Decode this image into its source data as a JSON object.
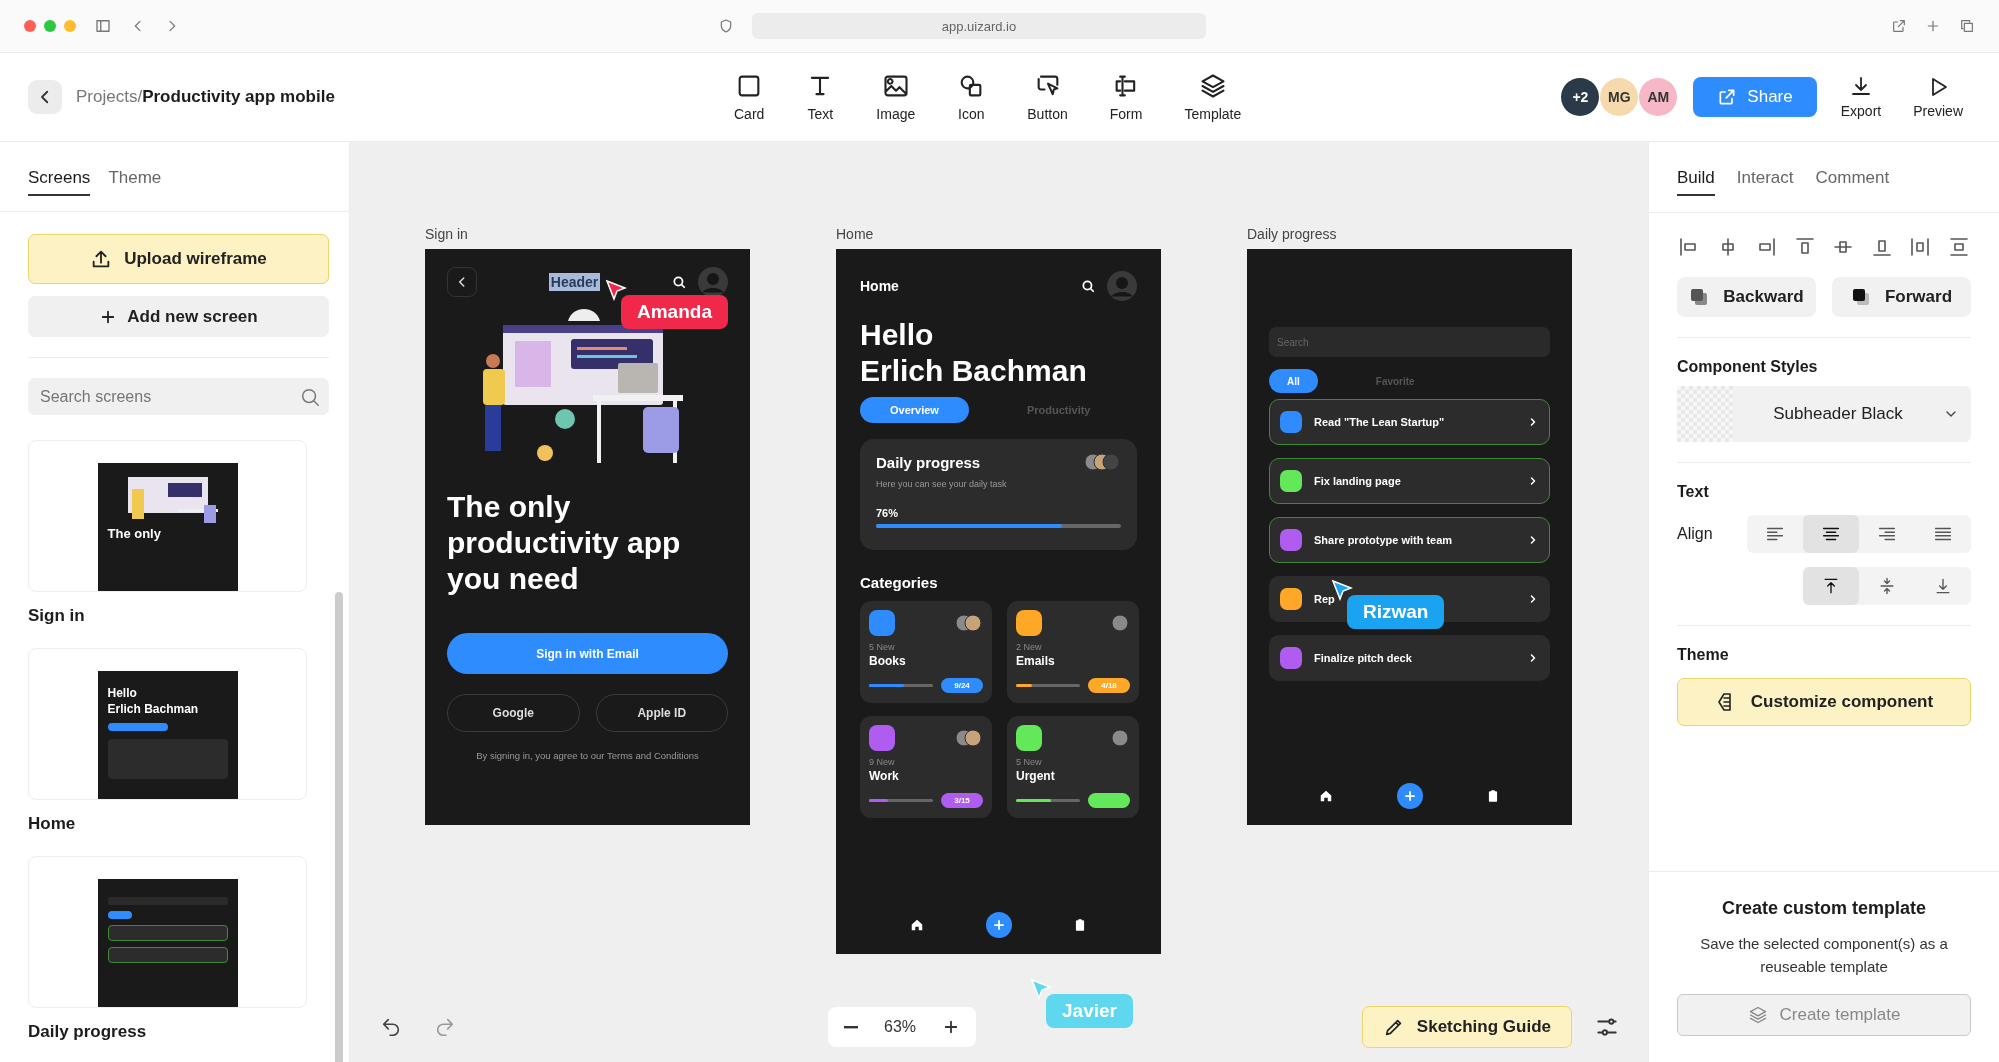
{
  "browser": {
    "url": "app.uizard.io"
  },
  "toolbar": {
    "breadcrumb_parent": "Projects",
    "breadcrumb_separator": "/",
    "breadcrumb_current": "Productivity app mobile",
    "tools": [
      {
        "label": "Card",
        "kind": "card"
      },
      {
        "label": "Text",
        "kind": "text"
      },
      {
        "label": "Image",
        "kind": "image"
      },
      {
        "label": "Icon",
        "kind": "icon"
      },
      {
        "label": "Button",
        "kind": "button"
      },
      {
        "label": "Form",
        "kind": "form"
      },
      {
        "label": "Template",
        "kind": "template"
      }
    ],
    "collaborators": [
      {
        "initials": "+2",
        "color": "#2b3a48"
      },
      {
        "initials": "MG",
        "color": "#f7d9ae"
      },
      {
        "initials": "AM",
        "color": "#f6b8c6"
      }
    ],
    "share": "Share",
    "actions": [
      {
        "label": "Export",
        "kind": "export"
      },
      {
        "label": "Preview",
        "kind": "preview"
      }
    ]
  },
  "left_panel": {
    "tabs": [
      {
        "label": "Screens",
        "selected": true
      },
      {
        "label": "Theme",
        "selected": false
      }
    ],
    "upload": "Upload wireframe",
    "add_screen": "Add new screen",
    "search": {
      "placeholder": "Search screens"
    },
    "screens": [
      {
        "name": "Sign in",
        "kind": "signin",
        "lines": [
          "The only"
        ]
      },
      {
        "name": "Home",
        "kind": "home",
        "lines": [
          "Hello",
          "Erlich Bachman"
        ]
      },
      {
        "name": "Daily progress",
        "kind": "progress"
      }
    ]
  },
  "canvas": {
    "screens": [
      {
        "label": "Sign in",
        "kind": "signin",
        "header": {
          "title": "Header",
          "selected": true
        },
        "cursor": {
          "name": "Amanda",
          "color": "#f0284a"
        },
        "headline": "The only productivity app you need",
        "primary": "Sign in with Email",
        "secondary": [
          "Google",
          "Apple ID"
        ],
        "terms": "By signing in, you agree to our Terms and Conditions"
      },
      {
        "label": "Home",
        "kind": "home",
        "title": "Home",
        "greeting": "Hello",
        "user": "Erlich Bachman",
        "tabs": [
          {
            "label": "Overview",
            "selected": true
          },
          {
            "label": "Productivity",
            "selected": false
          }
        ],
        "progress_card": {
          "title": "Daily progress",
          "subtitle": "Here you can see your daily task",
          "percent": "76%",
          "level": 0.76
        },
        "categories_title": "Categories",
        "categories": [
          {
            "count": "5 New",
            "name": "Books",
            "badge": "9/24",
            "level": 0.55,
            "color": "#2f8cff"
          },
          {
            "count": "2 New",
            "name": "Emails",
            "badge": "4/18",
            "level": 0.25,
            "color": "#ffa726"
          },
          {
            "count": "9 New",
            "name": "Work",
            "badge": "3/15",
            "level": 0.3,
            "color": "#b05cf0"
          },
          {
            "count": "5 New",
            "name": "Urgent",
            "level": 0.55,
            "color": "#63e85a"
          }
        ]
      },
      {
        "label": "Daily progress",
        "kind": "progress",
        "search": {
          "placeholder": "Search"
        },
        "tabs": [
          {
            "label": "All",
            "selected": true
          },
          {
            "label": "Favorite",
            "selected": false
          }
        ],
        "tasks": [
          {
            "title": "Read \"The Lean Startup\"",
            "color": "#2f8cff",
            "selected": true
          },
          {
            "title": "Fix landing page",
            "color": "#63e85a",
            "selected": true
          },
          {
            "title": "Share prototype with team",
            "color": "#b05cf0",
            "selected": true
          },
          {
            "title": "Rep",
            "color": "#ffa726",
            "selected": false
          },
          {
            "title": "Finalize pitch deck",
            "color": "#b05cf0",
            "selected": false
          }
        ],
        "cursor": {
          "name": "Rizwan",
          "color": "#1aa3f0"
        }
      }
    ],
    "cursor": {
      "name": "Javier",
      "color": "#5fd8ef"
    },
    "zoom": "63%",
    "guide": "Sketching Guide"
  },
  "right_panel": {
    "tabs": [
      {
        "label": "Build",
        "selected": true
      },
      {
        "label": "Interact",
        "selected": false
      },
      {
        "label": "Comment",
        "selected": false
      }
    ],
    "arrange": [
      {
        "kind": "align-left"
      },
      {
        "kind": "align-hcenter"
      },
      {
        "kind": "align-right"
      },
      {
        "kind": "align-top"
      },
      {
        "kind": "align-vcenter"
      },
      {
        "kind": "align-bottom"
      },
      {
        "kind": "distribute-h"
      },
      {
        "kind": "distribute-v"
      }
    ],
    "order_buttons": [
      {
        "label": "Backward",
        "kind": "backward"
      },
      {
        "label": "Forward",
        "kind": "forward"
      }
    ],
    "styles_title": "Component Styles",
    "style_value": "Subheader Black",
    "text_title": "Text",
    "align_label": "Align",
    "h_align": [
      {
        "kind": "left",
        "selected": false
      },
      {
        "kind": "center",
        "selected": true
      },
      {
        "kind": "right",
        "selected": false
      },
      {
        "kind": "justify",
        "selected": false
      }
    ],
    "v_align": [
      {
        "kind": "top",
        "selected": true
      },
      {
        "kind": "middle",
        "selected": false
      },
      {
        "kind": "bottom",
        "selected": false
      }
    ],
    "theme_title": "Theme",
    "customize": "Customize component",
    "template_title": "Create custom template",
    "template_text": "Save the selected component(s) as a reuseable template",
    "template_button": "Create template"
  }
}
